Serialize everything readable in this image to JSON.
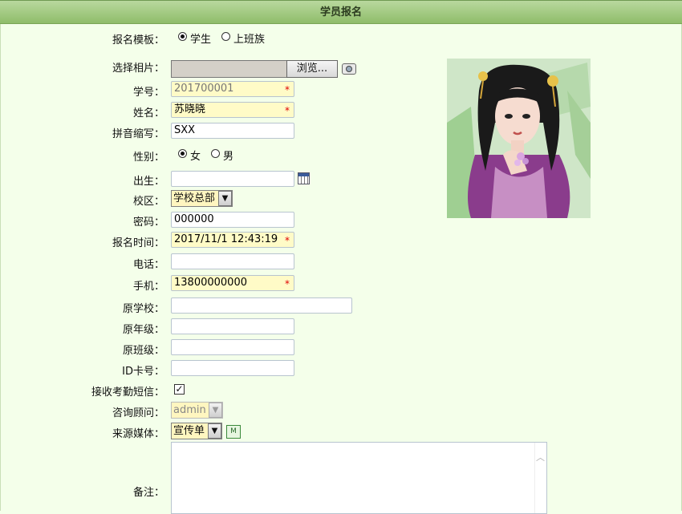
{
  "window": {
    "title": "学员报名"
  },
  "form": {
    "template": {
      "label": "报名模板：",
      "options": [
        "学生",
        "上班族"
      ],
      "selected": "学生"
    },
    "photo": {
      "label": "选择相片：",
      "browse_label": "浏览..."
    },
    "student_no": {
      "label": "学号：",
      "value": "201700001",
      "required": true
    },
    "name": {
      "label": "姓名：",
      "value": "苏晓晓",
      "required": true
    },
    "pinyin": {
      "label": "拼音缩写：",
      "value": "SXX"
    },
    "gender": {
      "label": "性别：",
      "options": [
        "女",
        "男"
      ],
      "selected": "女"
    },
    "birth": {
      "label": "出生：",
      "value": ""
    },
    "campus": {
      "label": "校区：",
      "value": "学校总部"
    },
    "password": {
      "label": "密码：",
      "value": "000000"
    },
    "signup_time": {
      "label": "报名时间：",
      "value": "2017/11/1 12:43:19",
      "required": true
    },
    "phone": {
      "label": "电话：",
      "value": ""
    },
    "mobile": {
      "label": "手机：",
      "value": "13800000000",
      "required": true
    },
    "prev_school": {
      "label": "原学校：",
      "value": ""
    },
    "prev_grade": {
      "label": "原年级：",
      "value": ""
    },
    "prev_class": {
      "label": "原班级：",
      "value": ""
    },
    "id_card": {
      "label": "ID卡号：",
      "value": ""
    },
    "sms": {
      "label": "接收考勤短信：",
      "checked": true
    },
    "consultant": {
      "label": "咨询顾问：",
      "value": "admin"
    },
    "source": {
      "label": "来源媒体：",
      "value": "宣传单"
    },
    "remarks": {
      "label": "备注：",
      "value": ""
    }
  },
  "colors": {
    "title_bar": "#9cc87a",
    "background": "#f4ffea",
    "required_field": "#fffbc7",
    "required_star": "#e00000"
  },
  "icons": {
    "camera": "camera-icon",
    "calendar": "calendar-icon",
    "media_manage": "media-manage-icon"
  }
}
